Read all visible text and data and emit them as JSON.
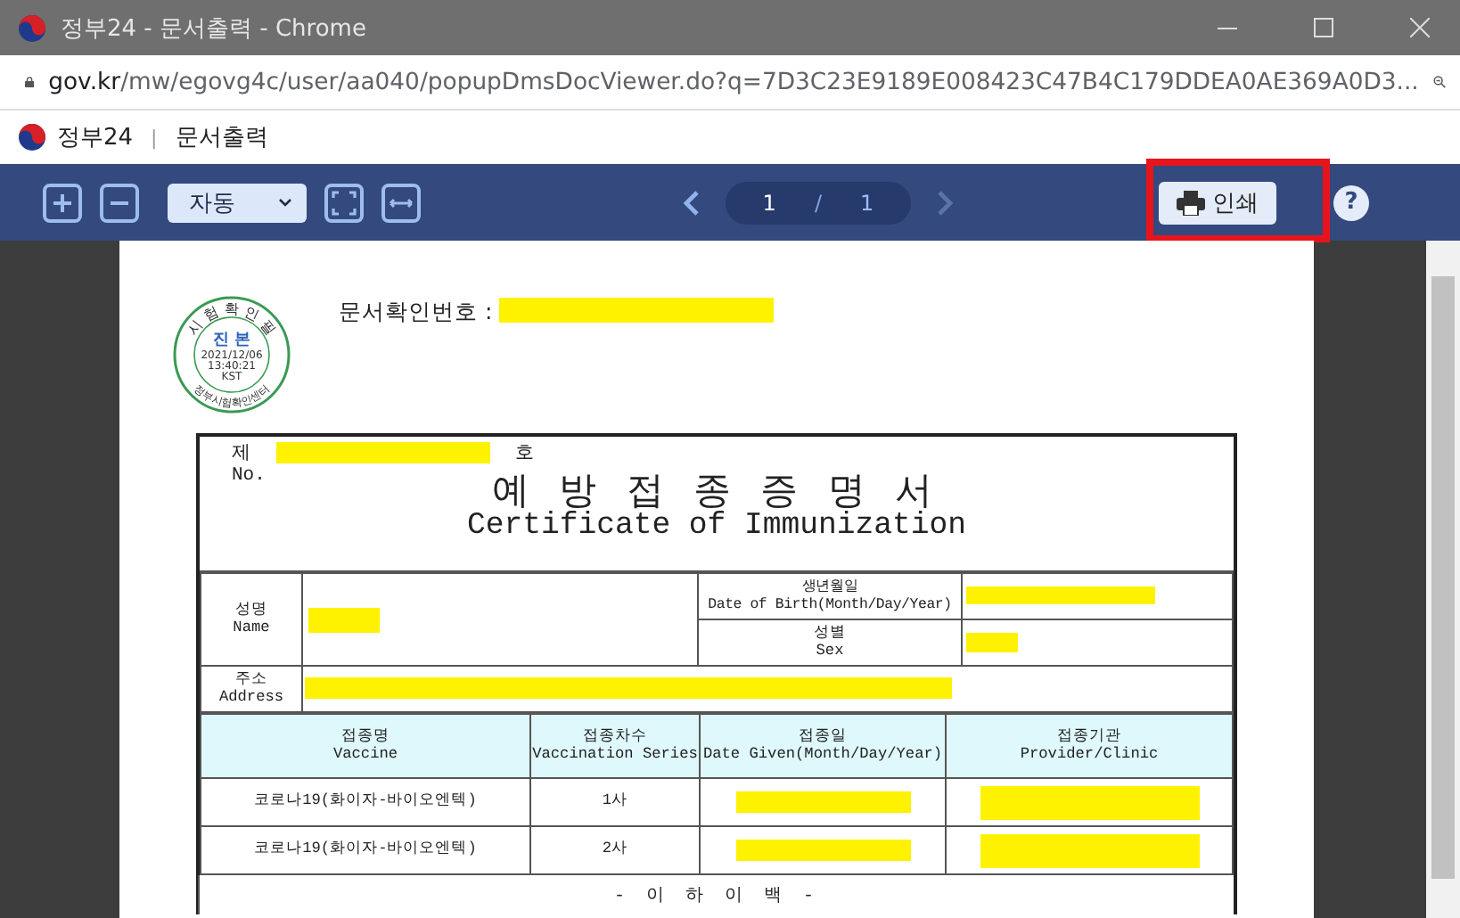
{
  "window": {
    "title": "정부24 - 문서출력 - Chrome",
    "url_host": "gov.kr",
    "url_path": "/mw/egovg4c/user/aa040/popupDmsDocViewer.do?q=7D3C23E9189E008423C47B4C179DDEA0AE369A0D3..."
  },
  "app_header": {
    "brand": "정부24",
    "divider": "|",
    "page": "문서출력"
  },
  "toolbar": {
    "zoom": "자동",
    "page": "1",
    "separator": "/",
    "pages": "1",
    "print": "인쇄",
    "help": "?",
    "print_highlighted": true
  },
  "document": {
    "confirmation_label": "문서확인번호 :",
    "stamp": {
      "top": "시 험 확 인 필",
      "mark": "진 본",
      "date": "2021/12/06",
      "time": "13:40:21",
      "zone": "KST",
      "bottom": "정부시험확인센터"
    },
    "number_prefix": "제",
    "number_suffix": "호",
    "number_label": "No.",
    "title_ko": "예 방 접 종 증 명 서",
    "title_en": "Certificate of Immunization",
    "name_label": [
      "성명",
      "Name"
    ],
    "birth_label": [
      "생년월일",
      "Date of Birth(Month/Day/Year)"
    ],
    "sex_label": [
      "성별",
      "Sex"
    ],
    "address_label": [
      "주소",
      "Address"
    ],
    "columns": [
      [
        "접종명",
        "Vaccine"
      ],
      [
        "접종차수",
        "Vaccination Series"
      ],
      [
        "접종일",
        "Date Given(Month/Day/Year)"
      ],
      [
        "접종기관",
        "Provider/Clinic"
      ]
    ],
    "rows": [
      {
        "vaccine": "코로나19(화이자-바이오엔텍)",
        "series": "1사"
      },
      {
        "vaccine": "코로나19(화이자-바이오엔텍)",
        "series": "2사"
      }
    ],
    "end_note": "- 이 하 이 백 -"
  }
}
